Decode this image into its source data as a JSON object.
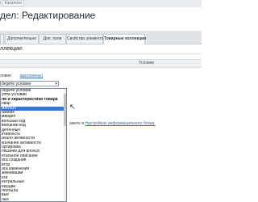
{
  "breadcrumb": {
    "separator": "/",
    "link": "Каталоги"
  },
  "page": {
    "title": "дел: Редактирование"
  },
  "tabs": [
    {
      "label": ""
    },
    {
      "label": "Дополнительно"
    },
    {
      "label": "Доп. поля"
    },
    {
      "label": "Свойства элементов"
    },
    {
      "label": "Товарные коллекции"
    }
  ],
  "section": {
    "label": "ллекции:"
  },
  "table": {
    "column_header": "Условие"
  },
  "row": {
    "label": "ловие",
    "link": "выполнены)"
  },
  "select": {
    "value": "берите условие",
    "arrow": "▾"
  },
  "dropdown": {
    "options": [
      {
        "label": "берите условие",
        "bold": false,
        "selected": false
      },
      {
        "label": "уппа условий",
        "bold": false,
        "selected": false
      },
      {
        "label": "ля и характеристики товара",
        "bold": true,
        "selected": false
      },
      {
        "label": "овар",
        "bold": false,
        "selected": false
      },
      {
        "label": "ментыл",
        "bold": false,
        "selected": true
      },
      {
        "label": "азание",
        "bold": false,
        "selected": false
      },
      {
        "label": "мвидел",
        "bold": false,
        "selected": false
      },
      {
        "label": "вольный код",
        "bold": false,
        "selected": false
      },
      {
        "label": "внешний код",
        "bold": false,
        "selected": false
      },
      {
        "label": "деленные",
        "bold": false,
        "selected": false
      },
      {
        "label": "ктивность",
        "bold": false,
        "selected": false
      },
      {
        "label": "ачало активности",
        "bold": false,
        "selected": false
      },
      {
        "label": "кончание активности",
        "bold": false,
        "selected": false
      },
      {
        "label": "ортировка",
        "bold": false,
        "selected": false
      },
      {
        "label": "писание для анонса",
        "bold": false,
        "selected": false
      },
      {
        "label": "етальное описание",
        "bold": false,
        "selected": false
      },
      {
        "label": "ата создания",
        "bold": false,
        "selected": false
      },
      {
        "label": "втор",
        "bold": false,
        "selected": false
      },
      {
        "label": "ата изменения",
        "bold": false,
        "selected": false
      },
      {
        "label": "зменивший",
        "bold": false,
        "selected": false
      },
      {
        "label": "еги",
        "bold": false,
        "selected": false
      },
      {
        "label": "ентральные",
        "bold": false,
        "selected": false
      },
      {
        "label": "екущие",
        "bold": false,
        "selected": false
      },
      {
        "label": "лентыла",
        "bold": false,
        "selected": false
      },
      {
        "label": "вые",
        "bold": false,
        "selected": false
      },
      {
        "label": "ные",
        "bold": false,
        "selected": false
      }
    ]
  },
  "info": {
    "prefix": "ажите в",
    "link": "Настройках информационного блока."
  }
}
